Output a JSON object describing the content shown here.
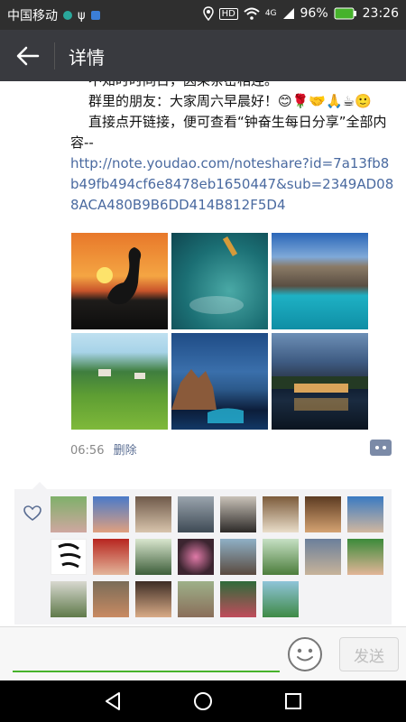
{
  "status": {
    "carrier": "中国移动",
    "battery": "96%",
    "time": "23:26",
    "network": "4G",
    "hd": "HD"
  },
  "header": {
    "title": "详情"
  },
  "post": {
    "line1": "不知时时同日，因果亲密相连。",
    "line2": "群里的朋友：大家周六早晨好！😊🌹🤝🙏☕🙂",
    "line3": "直接点开链接，便可查看“钟奋生每日分享”全部内容--",
    "link": "http://note.youdao.com/noteshare?id=7a13fb8b49fb494cf6e8478eb1650447&sub=2349AD088ACA480B9B6DD414B812F5D4",
    "time": "06:56",
    "delete_label": "删除"
  },
  "likers_count": 24,
  "input": {
    "placeholder": "",
    "send_label": "发送"
  },
  "colors": {
    "statusbar": "#2f2f2f",
    "titlebar": "#393a3f",
    "link": "#4a6aa0",
    "accent": "#46b22b"
  }
}
